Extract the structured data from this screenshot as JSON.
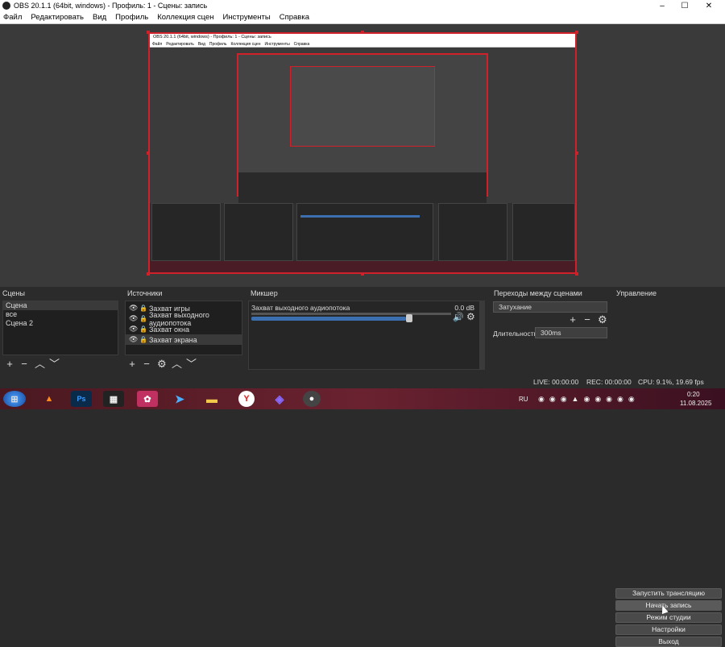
{
  "window": {
    "title": "OBS 20.1.1 (64bit, windows) - Профиль: 1 - Сцены: запись"
  },
  "menu": [
    "Файл",
    "Редактировать",
    "Вид",
    "Профиль",
    "Коллекция сцен",
    "Инструменты",
    "Справка"
  ],
  "docks": {
    "scenes": {
      "title": "Сцены",
      "items": [
        "Сцена",
        "все",
        "Сцена 2"
      ],
      "selected": 0
    },
    "sources": {
      "title": "Источники",
      "items": [
        "Захват игры",
        "Захват выходного аудиопотока",
        "Захват окна",
        "Захват экрана"
      ],
      "selected": 3
    },
    "mixer": {
      "title": "Микшер",
      "channel": "Захват выходного аудиопотока",
      "level": "0.0 dB",
      "volume_fraction": 0.8
    },
    "transitions": {
      "title": "Переходы между сценами",
      "type": "Затухание",
      "duration_label": "Длительность",
      "duration_value": "300ms"
    },
    "controls": {
      "title": "Управление",
      "buttons": [
        "Запустить трансляцию",
        "Начать запись",
        "Режим студии",
        "Настройки",
        "Выход"
      ]
    }
  },
  "status": {
    "live": "LIVE: 00:00:00",
    "rec": "REC: 00:00:00",
    "cpu": "CPU: 9.1%, 19.69 fps"
  },
  "taskbar": {
    "language": "RU",
    "time": "0:20",
    "date": "11.08.2025",
    "apps": [
      "start",
      "vlc",
      "photoshop",
      "film",
      "media",
      "telegram",
      "folder",
      "yandex",
      "vpn",
      "obs"
    ]
  },
  "colors": {
    "accent": "#d0202a",
    "volume": "#3c6fb0"
  }
}
